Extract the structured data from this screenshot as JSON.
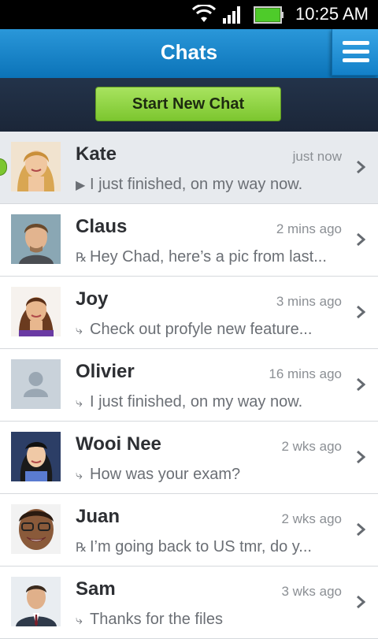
{
  "status_bar": {
    "time": "10:25 AM"
  },
  "header": {
    "title": "Chats"
  },
  "actions": {
    "start_new_chat_label": "Start New Chat"
  },
  "chats": [
    {
      "name": "Kate",
      "time": "just now",
      "preview": "I just finished, on my way now.",
      "preview_icon": "play-icon",
      "active": true
    },
    {
      "name": "Claus",
      "time": "2 mins ago",
      "preview": "Hey Chad, here’s a pic from last...",
      "preview_icon": "reply-icon"
    },
    {
      "name": "Joy",
      "time": "3 mins ago",
      "preview": "Check out profyle new feature...",
      "preview_icon": "sent-icon"
    },
    {
      "name": "Olivier",
      "time": "16 mins ago",
      "preview": "I just finished, on my way now.",
      "preview_icon": "sent-icon"
    },
    {
      "name": "Wooi Nee",
      "time": "2 wks ago",
      "preview": "How was your exam?",
      "preview_icon": "sent-icon"
    },
    {
      "name": "Juan",
      "time": "2 wks ago",
      "preview": "I’m going back to US tmr, do y...",
      "preview_icon": "reply-icon"
    },
    {
      "name": "Sam",
      "time": "3 wks ago",
      "preview": "Thanks for the files",
      "preview_icon": "sent-icon"
    }
  ]
}
